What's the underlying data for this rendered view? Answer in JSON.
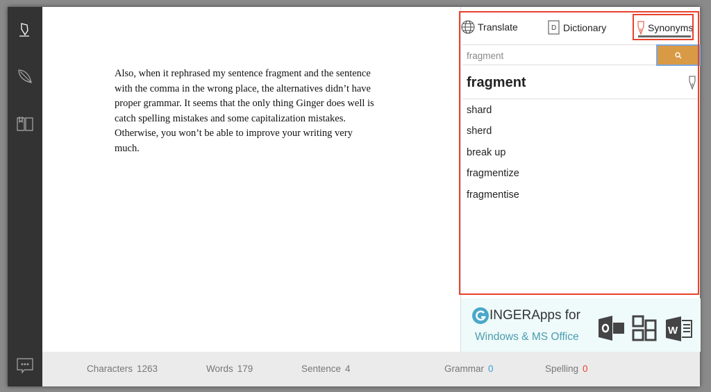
{
  "sidebar": {
    "items": [
      {
        "icon": "pen-icon"
      },
      {
        "icon": "feather-icon"
      },
      {
        "icon": "book-icon"
      }
    ],
    "bottom_icon": "chat-icon"
  },
  "document": {
    "text": "Also, when it rephrased my sentence fragment and the sentence with the comma in the wrong place, the alternatives didn’t have proper grammar. It seems that the only thing Ginger does well is catch spelling mistakes and some capitalization mistakes. Otherwise, you won’t be able to improve your writing very much."
  },
  "status": {
    "characters_label": "Characters",
    "characters": "1263",
    "words_label": "Words",
    "words": "179",
    "sentence_label": "Sentence",
    "sentence": "4",
    "grammar_label": "Grammar",
    "grammar": "0",
    "spelling_label": "Spelling",
    "spelling": "0"
  },
  "panel": {
    "tabs": [
      {
        "label": "Translate",
        "icon": "globe-icon"
      },
      {
        "label": "Dictionary",
        "icon": "dictionary-icon"
      },
      {
        "label": "Synonyms",
        "icon": "pen-icon",
        "active": true
      }
    ],
    "search_value": "fragment",
    "word": "fragment",
    "synonyms": [
      "shard",
      "sherd",
      "break up",
      "fragmentize",
      "fragmentise"
    ],
    "ad": {
      "brand": "INGER",
      "line1": " Apps for",
      "line2": "Windows & MS Office"
    }
  },
  "colors": {
    "accent": "#d99a45",
    "highlight": "#e8412c",
    "grammar": "#3a9ad9",
    "spelling": "#e8412c"
  }
}
